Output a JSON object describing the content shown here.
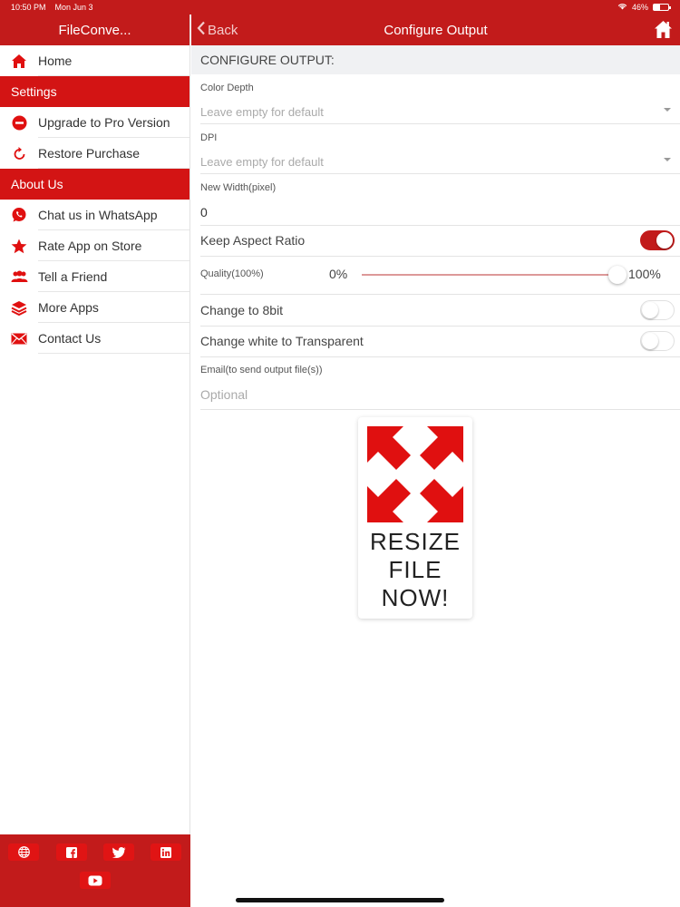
{
  "status_bar": {
    "time": "10:50 PM",
    "date": "Mon Jun 3",
    "battery": "46%"
  },
  "sidebar": {
    "title": "FileConve...",
    "home_label": "Home",
    "settings_header": "Settings",
    "settings_items": [
      {
        "label": "Upgrade to Pro Version",
        "icon": "minus-circle-icon"
      },
      {
        "label": "Restore Purchase",
        "icon": "refresh-icon"
      }
    ],
    "about_header": "About Us",
    "about_items": [
      {
        "label": "Chat us in WhatsApp",
        "icon": "whatsapp-icon"
      },
      {
        "label": "Rate App on Store",
        "icon": "star-icon"
      },
      {
        "label": "Tell a Friend",
        "icon": "people-icon"
      },
      {
        "label": "More Apps",
        "icon": "layers-icon"
      },
      {
        "label": "Contact Us",
        "icon": "mail-icon"
      }
    ],
    "social": [
      "globe-icon",
      "facebook-icon",
      "twitter-icon",
      "linkedin-icon",
      "youtube-icon"
    ]
  },
  "nav": {
    "back_label": "Back",
    "title": "Configure Output"
  },
  "form": {
    "section_title": "CONFIGURE OUTPUT:",
    "color_depth": {
      "label": "Color Depth",
      "placeholder": "Leave empty for default"
    },
    "dpi": {
      "label": "DPI",
      "placeholder": "Leave empty for default"
    },
    "new_width": {
      "label": "New Width(pixel)",
      "value": "0"
    },
    "keep_aspect": {
      "label": "Keep Aspect Ratio",
      "on": true
    },
    "quality": {
      "label": "Quality(100%)",
      "min_label": "0%",
      "max_label": "100%",
      "value": 1.0
    },
    "change_8bit": {
      "label": "Change to 8bit",
      "on": false
    },
    "white_transparent": {
      "label": "Change white to Transparent",
      "on": false
    },
    "email": {
      "label": "Email(to send output file(s))",
      "placeholder": "Optional"
    }
  },
  "resize_button": {
    "line1": "RESIZE",
    "line2": "FILE",
    "line3": "NOW!"
  },
  "colors": {
    "brand_red": "#c21b1b",
    "section_red": "#d31414",
    "icon_red": "#e01010"
  }
}
